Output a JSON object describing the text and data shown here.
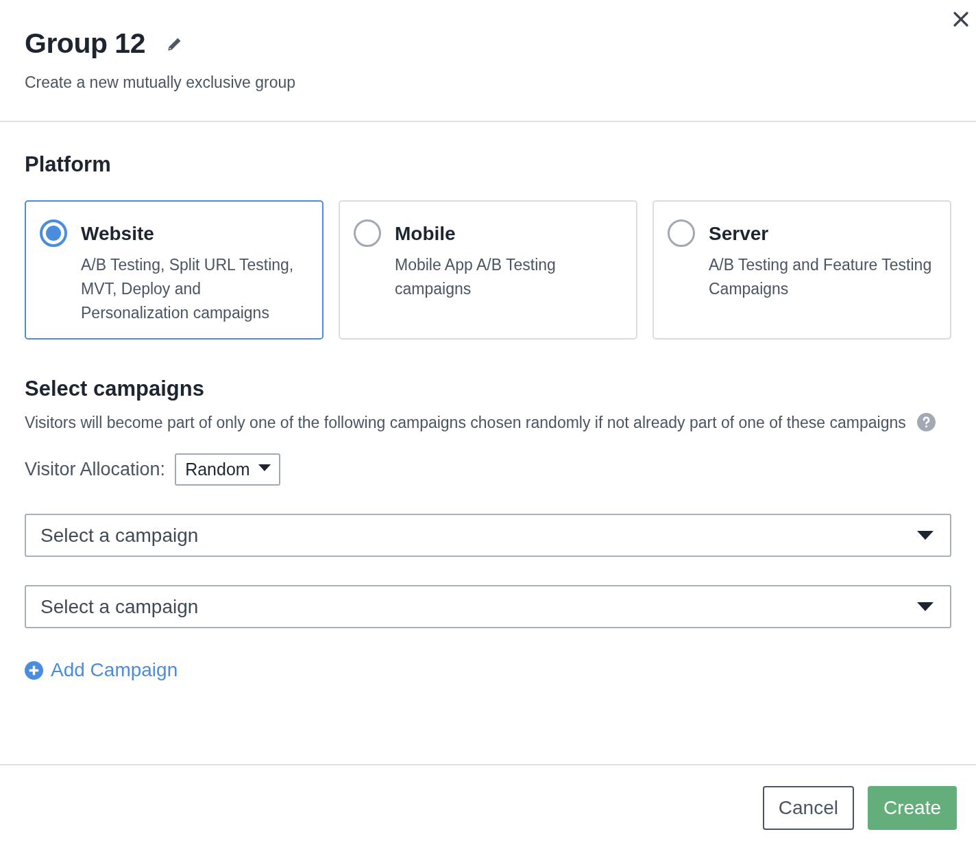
{
  "header": {
    "title": "Group 12",
    "subtitle": "Create a new mutually exclusive group"
  },
  "platform": {
    "heading": "Platform",
    "options": [
      {
        "label": "Website",
        "description": "A/B Testing, Split URL Testing, MVT, Deploy and Personalization campaigns",
        "selected": true
      },
      {
        "label": "Mobile",
        "description": "Mobile App A/B Testing campaigns",
        "selected": false
      },
      {
        "label": "Server",
        "description": "A/B Testing and Feature Testing Campaigns",
        "selected": false
      }
    ]
  },
  "campaigns": {
    "heading": "Select campaigns",
    "description": "Visitors will become part of only one of the following campaigns chosen randomly if not already part of one of these campaigns",
    "allocation_label": "Visitor Allocation:",
    "allocation_value": "Random",
    "selects": [
      {
        "placeholder": "Select a campaign"
      },
      {
        "placeholder": "Select a campaign"
      }
    ],
    "add_link": "Add Campaign"
  },
  "footer": {
    "buttons": [
      {
        "label": "Cancel",
        "kind": "secondary"
      },
      {
        "label": "Create",
        "kind": "primary"
      }
    ]
  }
}
